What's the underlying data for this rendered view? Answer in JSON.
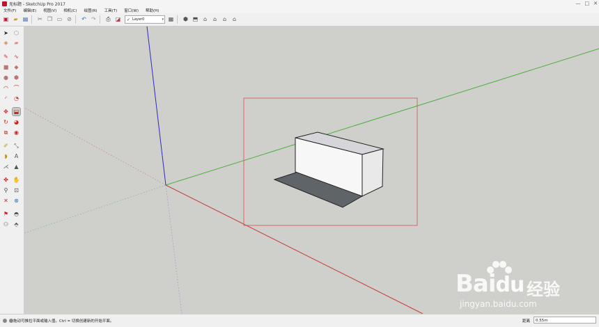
{
  "window": {
    "title": "无标题 - SketchUp Pro 2017",
    "controls": [
      "—",
      "□",
      "✕"
    ]
  },
  "menu": [
    "文件(F)",
    "编辑(E)",
    "视图(V)",
    "相机(C)",
    "绘图(R)",
    "工具(T)",
    "窗口(W)",
    "帮助(H)"
  ],
  "toolbar": {
    "layer_check": "✓",
    "layer_name": "Layer0",
    "dropdown_arrow": "▾"
  },
  "status": {
    "message": "拖动可推拉平面或输入值。Ctrl = 切换创建新的开始平面。",
    "measure_label": "距离",
    "measure_value": "0.55m"
  },
  "watermark": {
    "logo_bai": "Bai",
    "logo_du": "du",
    "logo_cn": "经验",
    "url": "jingyan.baidu.com"
  },
  "colors": {
    "red_axis": "#c63a3a",
    "green_axis": "#4fae3f",
    "blue_axis": "#2b2bc4",
    "viewport_bg": "#cfcfcb",
    "selection_box": "#d45050"
  }
}
